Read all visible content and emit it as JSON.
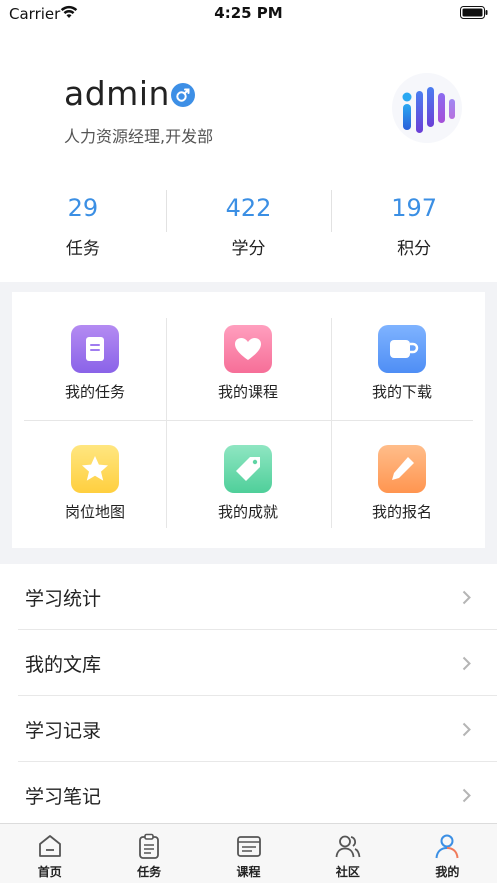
{
  "status_bar": {
    "carrier": "Carrier",
    "time": "4:25 PM"
  },
  "profile": {
    "username": "admin",
    "subtitle": "人力资源经理,开发部",
    "gender_icon": "male-icon",
    "stats": [
      {
        "value": "29",
        "label": "任务"
      },
      {
        "value": "422",
        "label": "学分"
      },
      {
        "value": "197",
        "label": "积分"
      }
    ]
  },
  "grid": [
    {
      "label": "我的任务",
      "icon": "document-icon",
      "color_top": "#b48bf2",
      "color_bottom": "#8a63e8"
    },
    {
      "label": "我的课程",
      "icon": "heart-icon",
      "color_top": "#ff9fbe",
      "color_bottom": "#f66f98"
    },
    {
      "label": "我的下载",
      "icon": "cup-icon",
      "color_top": "#7fb3ff",
      "color_bottom": "#4f8ef5"
    },
    {
      "label": "岗位地图",
      "icon": "star-icon",
      "color_top": "#ffe680",
      "color_bottom": "#ffcf3f"
    },
    {
      "label": "我的成就",
      "icon": "tag-icon",
      "color_top": "#8fe6c2",
      "color_bottom": "#4fcf9a"
    },
    {
      "label": "我的报名",
      "icon": "pencil-icon",
      "color_top": "#ffbd8a",
      "color_bottom": "#ff9550"
    }
  ],
  "list": [
    {
      "label": "学习统计"
    },
    {
      "label": "我的文库"
    },
    {
      "label": "学习记录"
    },
    {
      "label": "学习笔记"
    }
  ],
  "tabs": [
    {
      "label": "首页",
      "icon": "home-icon"
    },
    {
      "label": "任务",
      "icon": "clipboard-icon"
    },
    {
      "label": "课程",
      "icon": "course-icon"
    },
    {
      "label": "社区",
      "icon": "community-icon"
    },
    {
      "label": "我的",
      "icon": "user-icon",
      "active": true
    }
  ],
  "colors": {
    "accent": "#3b8fe4",
    "background": "#f2f3f6",
    "active_tab": "#3b8fe4"
  }
}
